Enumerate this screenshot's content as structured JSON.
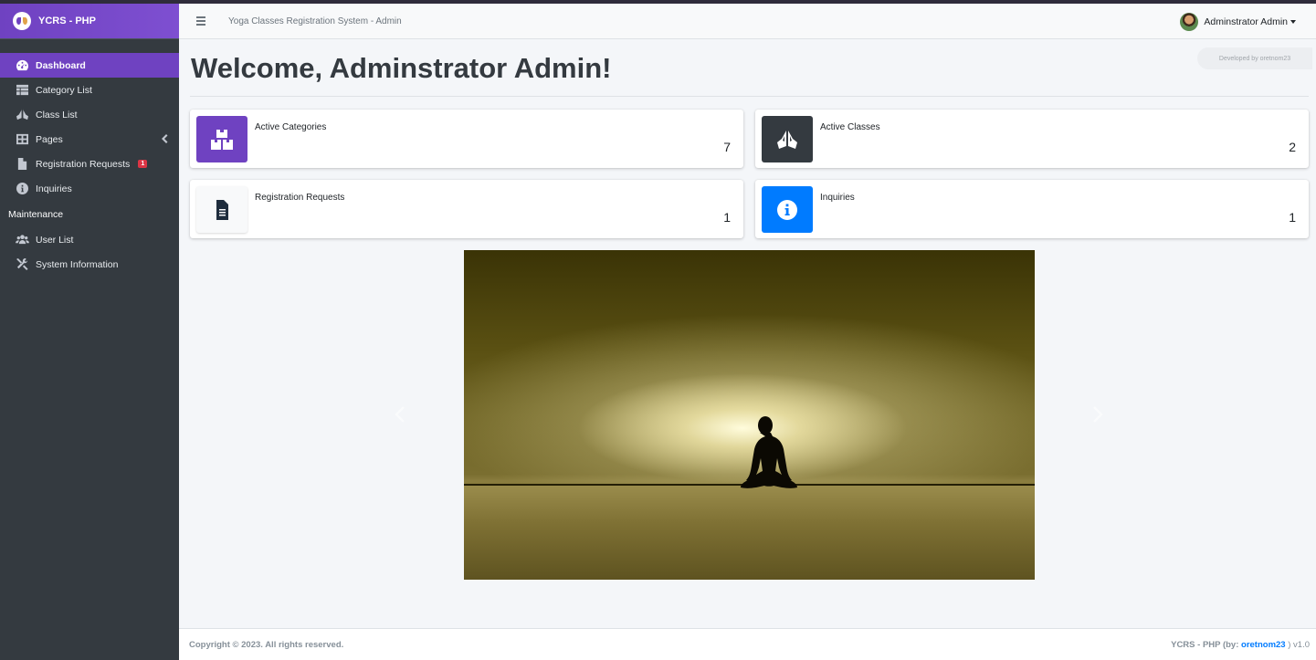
{
  "brand": {
    "name": "YCRS - PHP"
  },
  "navbar": {
    "title": "Yoga Classes Registration System - Admin",
    "user_name": "Adminstrator Admin"
  },
  "sidebar": {
    "items": [
      {
        "label": "Dashboard",
        "icon": "dashboard-icon",
        "active": true
      },
      {
        "label": "Category List",
        "icon": "table-icon"
      },
      {
        "label": "Class List",
        "icon": "praying-hands-icon"
      },
      {
        "label": "Pages",
        "icon": "grid-icon",
        "has_children": true
      },
      {
        "label": "Registration Requests",
        "icon": "file-icon",
        "badge": "1"
      },
      {
        "label": "Inquiries",
        "icon": "info-circle-icon"
      }
    ],
    "maintenance_header": "Maintenance",
    "maintenance_items": [
      {
        "label": "User List",
        "icon": "users-icon"
      },
      {
        "label": "System Information",
        "icon": "tools-icon"
      }
    ]
  },
  "content": {
    "title": "Welcome, Adminstrator Admin!",
    "developed_by": "Developed by oretnom23",
    "cards": [
      {
        "label": "Active Categories",
        "value": "7",
        "icon": "boxes-icon",
        "color": "#6f42c1"
      },
      {
        "label": "Active Classes",
        "value": "2",
        "icon": "praying-hands-icon",
        "color": "#343a40"
      },
      {
        "label": "Registration Requests",
        "value": "1",
        "icon": "file-icon",
        "color": "#f8f9fa"
      },
      {
        "label": "Inquiries",
        "value": "1",
        "icon": "info-circle-icon",
        "color": "#007bff"
      }
    ]
  },
  "footer": {
    "copyright": "Copyright © 2023. All rights reserved.",
    "app_name": "YCRS - PHP (by:",
    "author": "oretnom23",
    "version": ") v1.0"
  }
}
